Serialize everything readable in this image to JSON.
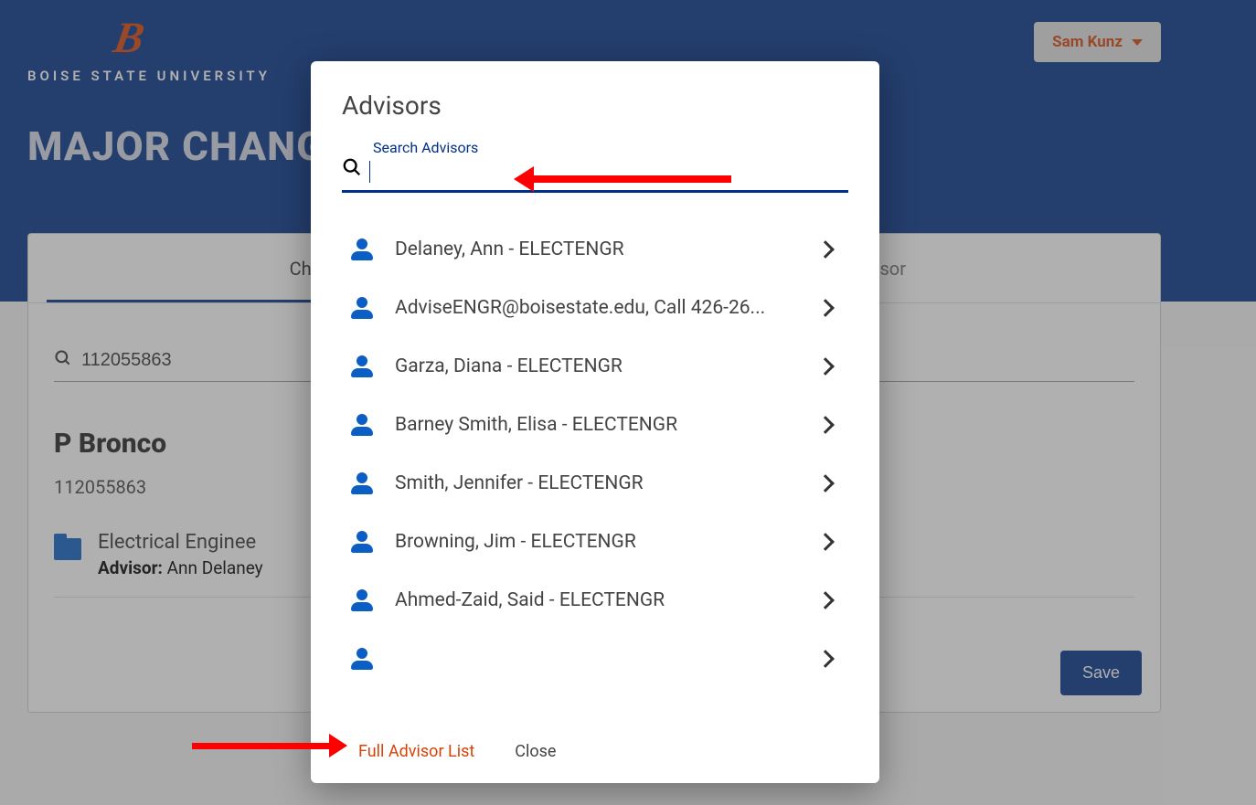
{
  "header": {
    "university_name": "BOISE STATE UNIVERSITY",
    "user_name": "Sam Kunz",
    "page_title": "MAJOR CHANGE"
  },
  "tabs": {
    "left": "Change",
    "right": "e Advisor"
  },
  "card": {
    "search_value": "112055863",
    "student_name": "P Bronco",
    "student_id": "112055863",
    "program": "Electrical Enginee",
    "advisor_label": "Advisor:",
    "advisor_name": "Ann Delaney",
    "save_label": "Save"
  },
  "modal": {
    "title": "Advisors",
    "search_label": "Search Advisors",
    "search_value": "",
    "advisors": [
      "Delaney, Ann - ELECTENGR",
      "AdviseENGR@boisestate.edu, Call 426-26...",
      "Garza, Diana - ELECTENGR",
      "Barney Smith, Elisa - ELECTENGR",
      "Smith, Jennifer - ELECTENGR",
      "Browning, Jim - ELECTENGR",
      "Ahmed-Zaid, Said - ELECTENGR"
    ],
    "footer_full_list": "Full Advisor List",
    "footer_close": "Close"
  }
}
